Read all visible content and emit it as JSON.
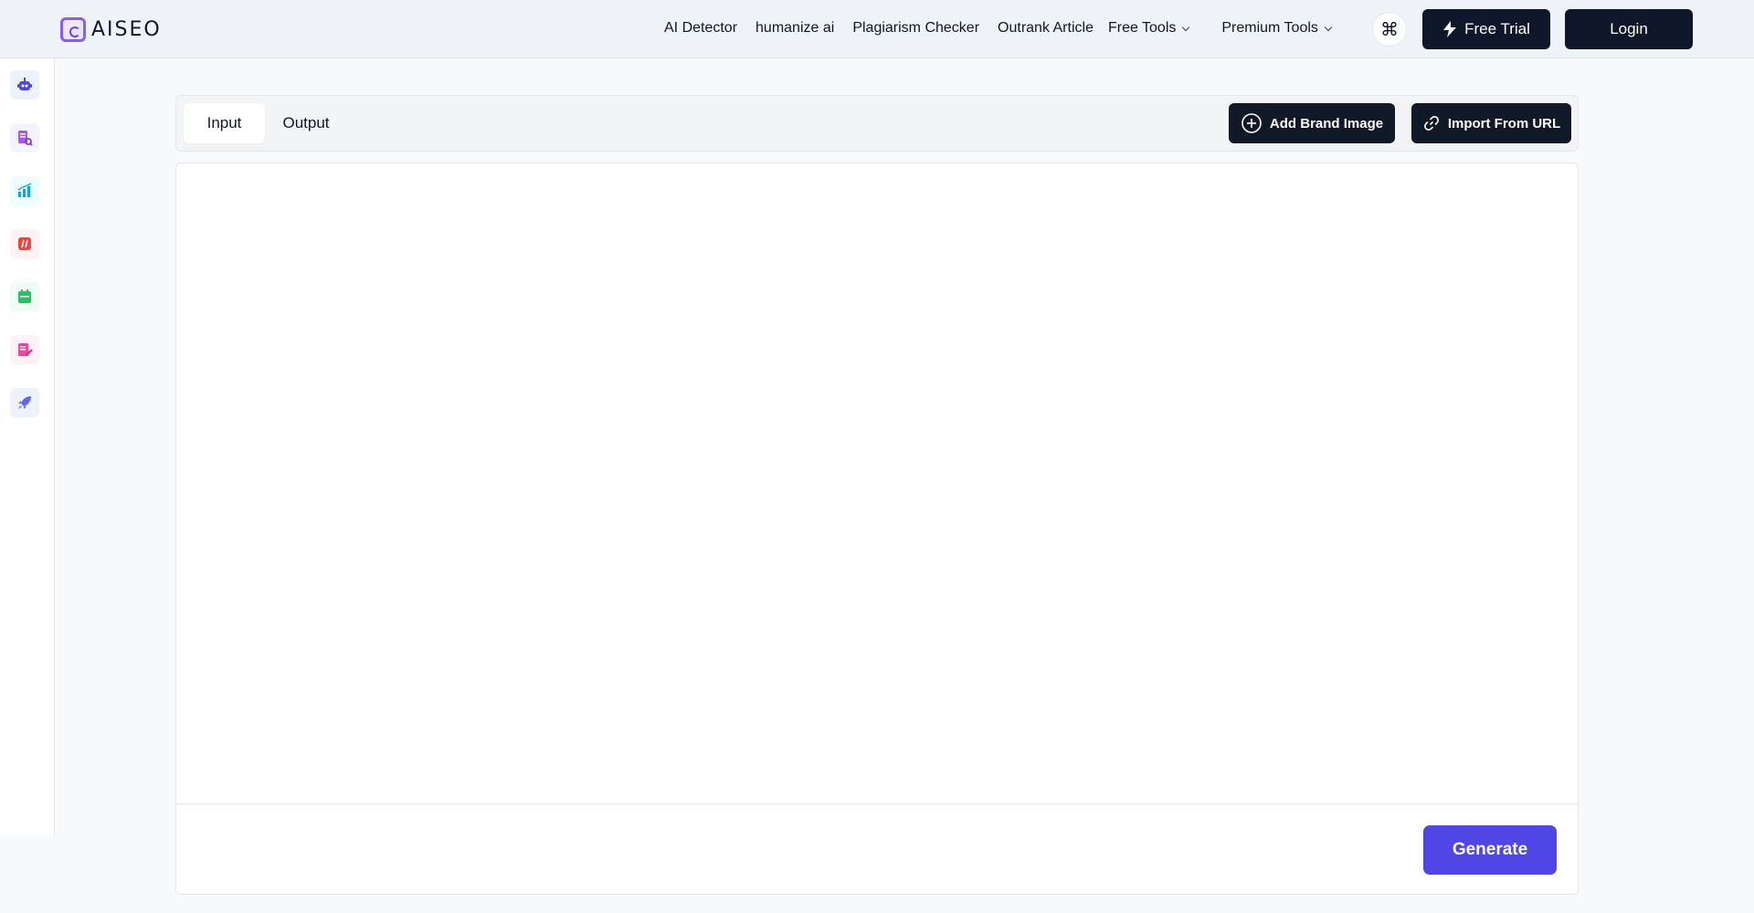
{
  "header": {
    "logo_text": "AISEO",
    "nav": {
      "ai_detector": "AI Detector",
      "humanize": "humanize ai",
      "plagiarism": "Plagiarism Checker",
      "outrank": "Outrank Article",
      "free_tools": "Free Tools",
      "premium_tools": "Premium Tools"
    },
    "command_icon": "⌘",
    "free_trial_label": "Free Trial",
    "login_label": "Login"
  },
  "sidebar": {
    "items": [
      {
        "icon": "robot-icon",
        "color": "#4f46e5",
        "bg": "#eef2ff"
      },
      {
        "icon": "document-search-icon",
        "color": "#a855f7",
        "bg": "#f5f3ff"
      },
      {
        "icon": "bar-chart-icon",
        "color": "#0ea5e9",
        "bg": "#ecfeff"
      },
      {
        "icon": "slash-tag-icon",
        "color": "#ef4444",
        "bg": "#fef2f2"
      },
      {
        "icon": "calendar-icon",
        "color": "#22c55e",
        "bg": "#f0fdf4"
      },
      {
        "icon": "edit-document-icon",
        "color": "#ec4899",
        "bg": "#fdf2f8"
      },
      {
        "icon": "rocket-icon",
        "color": "#6366f1",
        "bg": "#eef2ff"
      }
    ]
  },
  "main": {
    "tabs": {
      "input": "Input",
      "output": "Output"
    },
    "add_brand_image_label": "Add Brand Image",
    "import_url_label": "Import From URL",
    "editor_value": "",
    "generate_label": "Generate"
  }
}
